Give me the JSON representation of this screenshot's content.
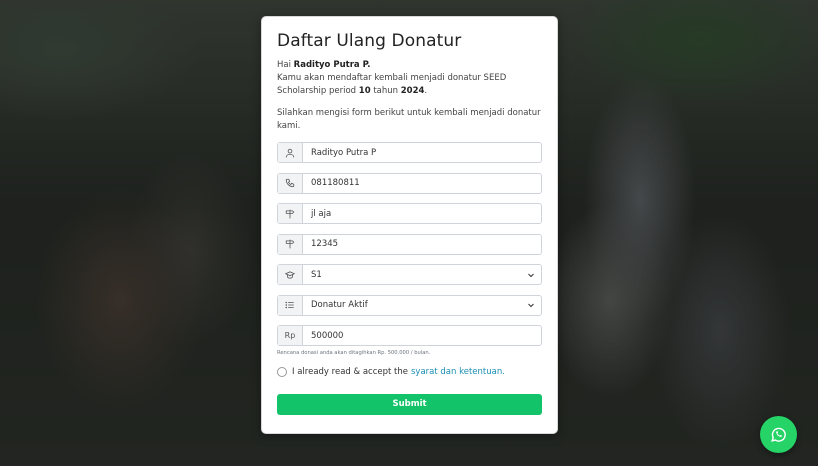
{
  "form": {
    "title": "Daftar Ulang Donatur",
    "greeting_prefix": "Hai ",
    "donor_name": "Radityo Putra P.",
    "greeting_suffix": "",
    "intro_line": "Kamu akan mendaftar kembali menjadi donatur SEED Scholarship period ",
    "period": "10",
    "year_prefix": " tahun ",
    "year": "2024",
    "year_suffix": ".",
    "instruction": "Silahkan mengisi form berikut untuk kembali menjadi donatur kami.",
    "fields": {
      "name": {
        "value": "Radityo Putra P",
        "icon": "user-icon"
      },
      "phone": {
        "value": "081180811",
        "icon": "phone-icon"
      },
      "address": {
        "value": "jl aja",
        "icon": "signpost-icon"
      },
      "postal": {
        "value": "12345",
        "icon": "signpost-icon"
      },
      "education": {
        "value": "S1",
        "icon": "graduation-cap-icon"
      },
      "status": {
        "value": "Donatur Aktif",
        "icon": "list-icon"
      },
      "donation": {
        "prefix": "Rp",
        "value": "500000"
      }
    },
    "donation_help": "Rencana donasi anda akan ditagihkan Rp. 500.000 / bulan.",
    "agree_text": "I already read & accept the",
    "agree_link": "syarat dan ketentuan.",
    "submit_label": "Submit"
  },
  "colors": {
    "submit": "#13c36a",
    "link": "#1a8fb3",
    "whatsapp": "#25d366"
  },
  "floating": {
    "icon": "whatsapp-icon"
  }
}
